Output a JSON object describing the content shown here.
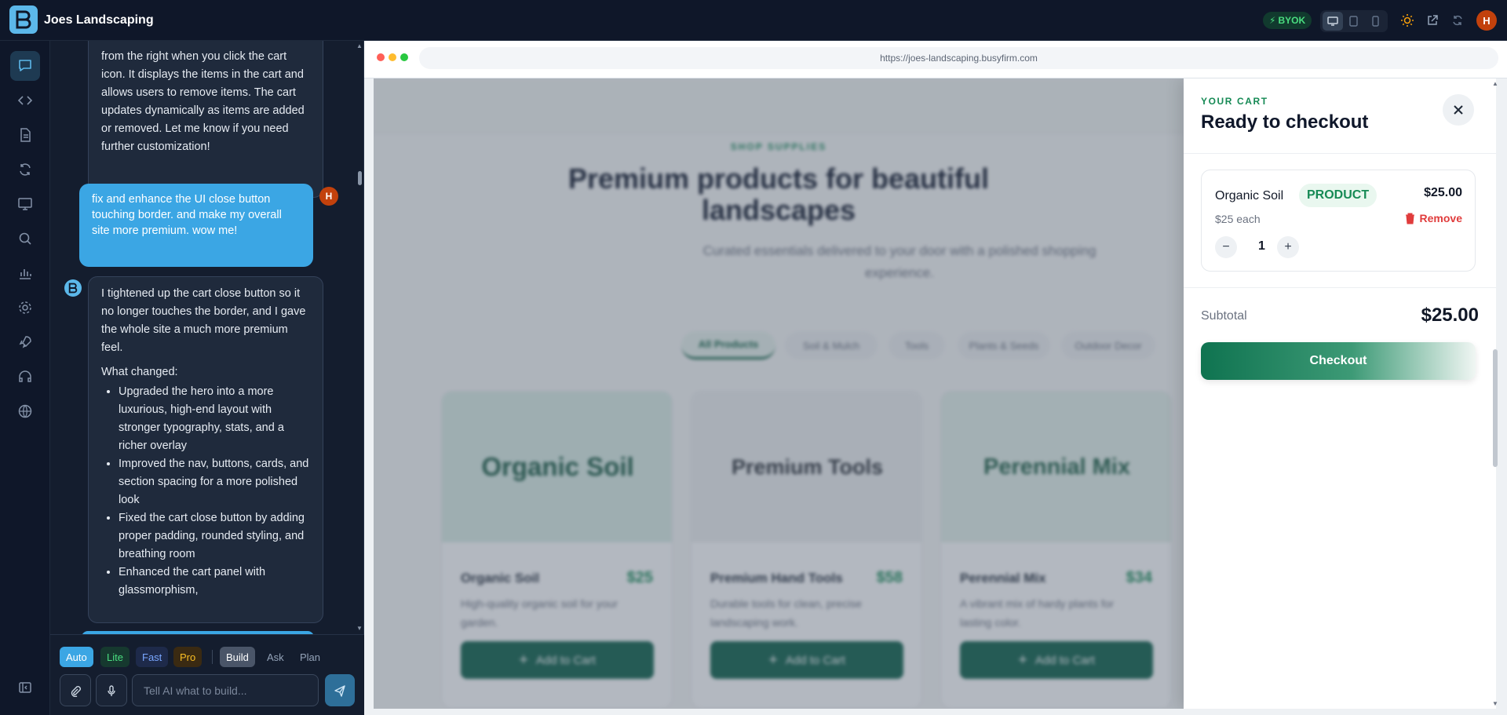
{
  "app": {
    "title": "Joes Landscaping",
    "byok": "BYOK",
    "user_initial": "H"
  },
  "rail": {
    "icons": [
      "chat-icon",
      "code-icon",
      "file-icon",
      "refresh-icon",
      "monitor-icon",
      "search-icon",
      "chart-icon",
      "gear-icon",
      "rocket-icon",
      "headset-icon",
      "globe-icon"
    ]
  },
  "chat": {
    "msg1_text": "from the right when you click the cart icon. It displays the items in the cart and allows users to remove items. The cart updates dynamically as items are added or removed. Let me know if you need further customization!",
    "user_text": "fix and enhance the UI close button touching border. and make my overall site more premium. wow me!",
    "msg2_intro": "I tightened up the cart close button so it no longer touches the border, and I gave the whole site a much more premium feel.",
    "msg2_heading": "What changed:",
    "msg2_items": [
      "Upgraded the hero into a more luxurious, high-end layout with stronger typography, stats, and a richer overlay",
      "Improved the nav, buttons, cards, and section spacing for a more polished look",
      "Fixed the cart close button by adding proper padding, rounded styling, and breathing room",
      "Enhanced the cart panel with glassmorphism,"
    ]
  },
  "composer": {
    "models": [
      "Auto",
      "Lite",
      "Fast",
      "Pro"
    ],
    "modes": [
      "Build",
      "Ask",
      "Plan"
    ],
    "placeholder": "Tell AI what to build..."
  },
  "browser": {
    "url": "https://joes-landscaping.busyfirm.com"
  },
  "site": {
    "eyebrow": "SHOP SUPPLIES",
    "hero_line1": "Premium products for beautiful",
    "hero_line2": "landscapes",
    "subtitle": "Curated essentials delivered to your door with a polished shopping experience.",
    "filters": [
      "All Products",
      "Soil & Mulch",
      "Tools",
      "Plants & Seeds",
      "Outdoor Decor"
    ],
    "products": [
      {
        "image_label": "Organic Soil",
        "name": "Organic Soil",
        "price": "$25",
        "desc": "High-quality organic soil for your garden.",
        "button": "Add to Cart"
      },
      {
        "image_label": "Premium Tools",
        "name": "Premium Hand Tools",
        "price": "$58",
        "desc": "Durable tools for clean, precise landscaping work.",
        "button": "Add to Cart"
      },
      {
        "image_label": "Perennial Mix",
        "name": "Perennial Mix",
        "price": "$34",
        "desc": "A vibrant mix of hardy plants for lasting color.",
        "button": "Add to Cart"
      }
    ]
  },
  "cart": {
    "eyebrow": "YOUR CART",
    "title": "Ready to checkout",
    "item": {
      "name": "Organic Soil",
      "badge": "PRODUCT",
      "price": "$25.00",
      "each": "$25 each",
      "remove": "Remove",
      "qty": "1"
    },
    "subtotal_label": "Subtotal",
    "subtotal_value": "$25.00",
    "checkout": "Checkout"
  },
  "colors": {
    "accent": "#3ba6e4",
    "brand_green": "#0c5f48",
    "danger": "#e03c3c"
  }
}
